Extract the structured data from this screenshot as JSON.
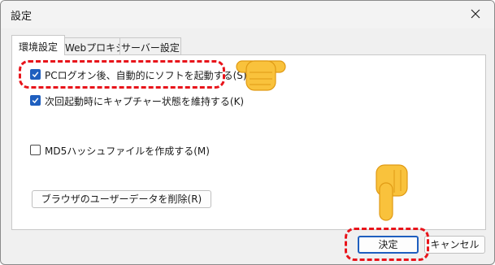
{
  "window": {
    "title": "設定"
  },
  "tabs": [
    {
      "label": "環境設定",
      "active": true
    },
    {
      "label": "Webプロキシ",
      "active": false
    },
    {
      "label": "サーバー設定",
      "active": false
    }
  ],
  "options": {
    "autostart": {
      "label": "PCログオン後、自動的にソフトを起動する(S)",
      "checked": true
    },
    "keep_capture": {
      "label": "次回起動時にキャプチャー状態を維持する(K)",
      "checked": true
    },
    "md5": {
      "label": "MD5ハッシュファイルを作成する(M)",
      "checked": false
    }
  },
  "buttons": {
    "delete_browser_data": "ブラウザのユーザーデータを削除(R)",
    "ok": "決定",
    "cancel": "キャンセル"
  },
  "annotations": {
    "highlight_color": "#e8141b",
    "pointer_emoji": "pointing-hand-icon"
  }
}
